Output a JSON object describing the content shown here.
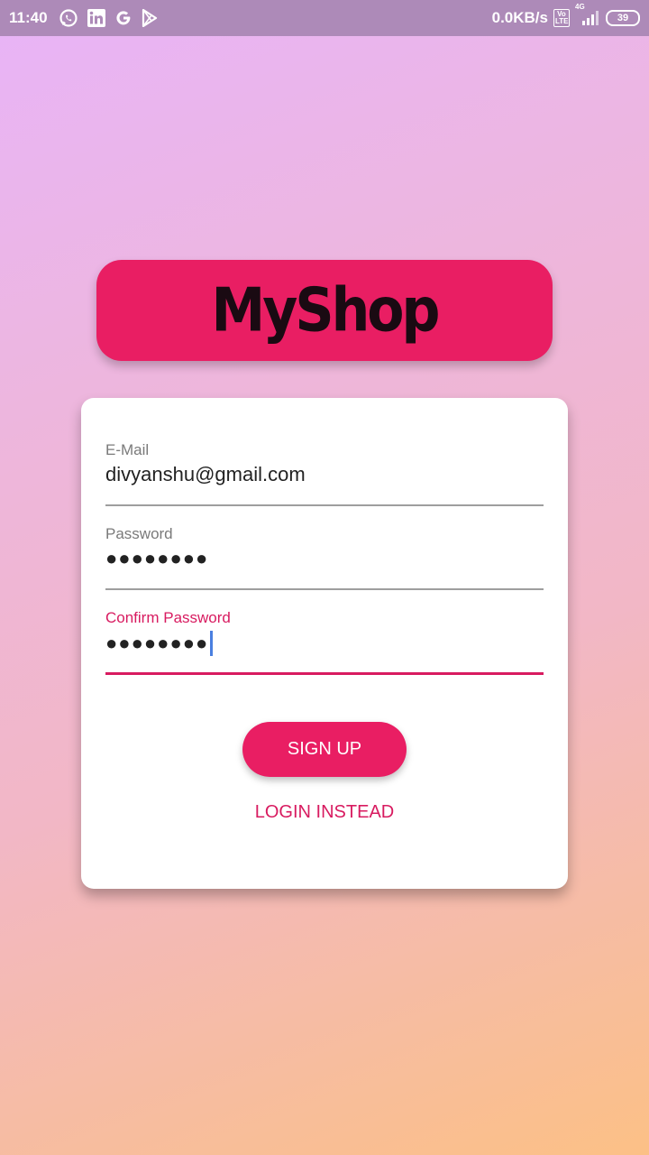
{
  "status_bar": {
    "time": "11:40",
    "left_icons": [
      "whatsapp-icon",
      "linkedin-icon",
      "google-icon",
      "play-store-icon"
    ],
    "network_speed": "0.0KB/s",
    "volte": "Vo LTE",
    "network_type": "4G",
    "battery": "39"
  },
  "logo": {
    "text": "MyShop"
  },
  "form": {
    "email": {
      "label": "E-Mail",
      "value": "divyanshu@gmail.com"
    },
    "password": {
      "label": "Password",
      "value": "●●●●●●●●"
    },
    "confirm_password": {
      "label": "Confirm Password",
      "value": "●●●●●●●●",
      "focused": true
    },
    "signup_label": "SIGN UP",
    "login_label": "LOGIN INSTEAD"
  },
  "colors": {
    "accent": "#e91e63",
    "accent_dark": "#d81b60",
    "status_bar": "#ad8ab8",
    "gradient_start": "#e8b4f8",
    "gradient_end": "#fcc086"
  }
}
